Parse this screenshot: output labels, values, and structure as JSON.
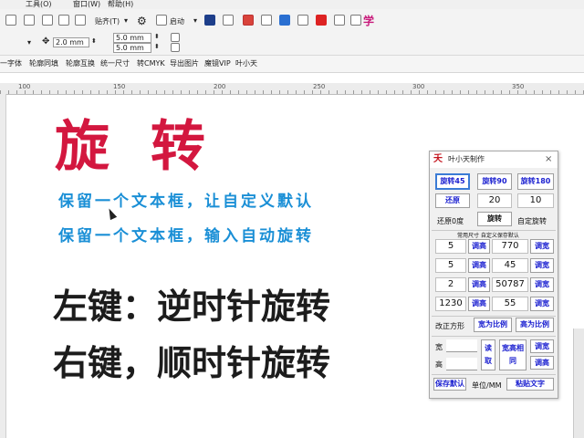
{
  "menubar": {
    "tools": "工具(O)",
    "window": "窗口(W)",
    "help": "帮助(H)"
  },
  "toolbar1": {
    "snap_label": "贴齐(T)",
    "launch_label": "启动"
  },
  "toolbar2": {
    "nudge_value": "2.0 mm",
    "dup_x": "5.0 mm",
    "dup_y": "5.0 mm"
  },
  "cmdbar": {
    "items": [
      "一字体",
      "轮廓同填",
      "轮廓互换",
      "统一尺寸",
      "转CMYK",
      "导出图片",
      "魔镜VIP",
      "叶小天"
    ]
  },
  "ruler": {
    "labels": [
      "100",
      "150",
      "200",
      "250",
      "300",
      "350"
    ]
  },
  "canvas": {
    "title": "旋 转",
    "line1": "保留一个文本框，让自定义默认",
    "line2": "保留一个文本框，输入自动旋转",
    "line3": "左键：逆时针旋转",
    "line4": "右键，顺时针旋转"
  },
  "panel": {
    "title": "叶小天制作",
    "close": "×",
    "rot45": "旋转45",
    "rot90": "旋转90",
    "rot180": "旋转180",
    "restore": "还原",
    "val20": "20",
    "val10": "10",
    "restore_zero": "还原0度",
    "rotate": "旋转",
    "custom_rotate": "自定旋转",
    "hint": "常用尺寸  自定义保存默认",
    "rows": [
      {
        "a": "5",
        "b": "调高",
        "c": "770",
        "d": "调宽"
      },
      {
        "a": "5",
        "b": "调高",
        "c": "45",
        "d": "调宽"
      },
      {
        "a": "2",
        "b": "调高",
        "c": "50787",
        "d": "调宽"
      },
      {
        "a": "1230",
        "b": "调高",
        "c": "55",
        "d": "调宽"
      }
    ],
    "reshape": "改正方形",
    "width_ratio": "宽为比例",
    "height_ratio": "高为比例",
    "w_label": "宽",
    "h_label": "高",
    "read_btn": "读取",
    "wh_equal": "宽高相同",
    "adj_w": "调宽",
    "adj_h": "调高",
    "save_default": "保存默认",
    "unit": "单位/MM",
    "paste_text": "粘贴文字"
  },
  "colors": {
    "title_red": "#d3173f",
    "blue_text": "#1a8fd6",
    "button_text": "#1a1fd0"
  }
}
